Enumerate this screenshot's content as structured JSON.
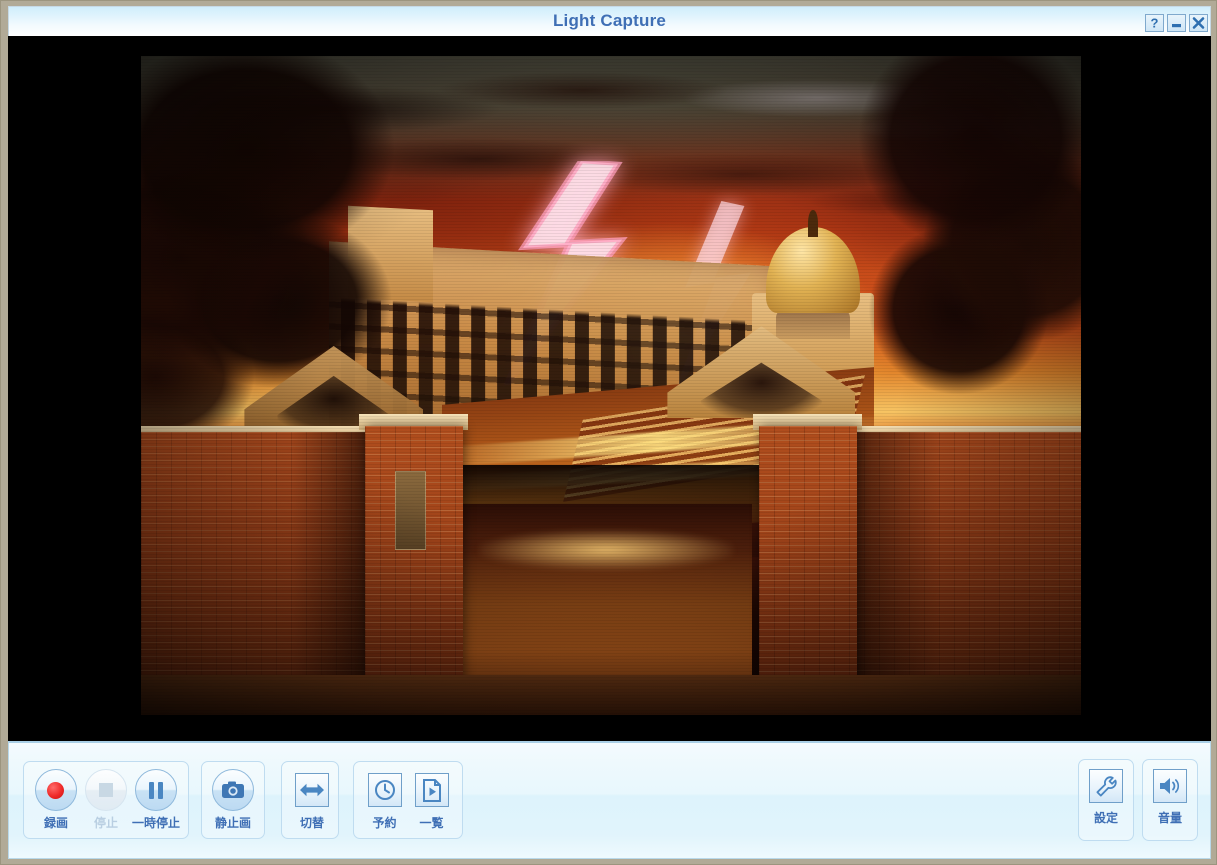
{
  "window": {
    "title": "Light Capture",
    "controls": [
      {
        "name": "help-button",
        "glyph": "?",
        "label": "?"
      },
      {
        "name": "minimize-button",
        "glyph": "_",
        "label": "_"
      },
      {
        "name": "close-button",
        "glyph": "X",
        "label": "X"
      }
    ],
    "frame_color": "#b1aa97",
    "title_color": "#3f6fb5"
  },
  "video": {
    "state": "live-preview",
    "background": "#000000",
    "scene_description": "Night scene with fiery red-orange storm sky, lightning bolt, dark tree silhouettes, a lit school building, a golden-domed hall and a brick gate with stone piers opening to a stepped path"
  },
  "toolbar": {
    "groups": [
      {
        "name": "recording-group",
        "buttons": [
          {
            "name": "record-button",
            "label": "録画",
            "icon": "record-dot-icon",
            "enabled": true,
            "icon_color": "#ef2a2a"
          },
          {
            "name": "stop-button",
            "label": "停止",
            "icon": "stop-square-icon",
            "enabled": false,
            "icon_color": "#c8d8e4"
          },
          {
            "name": "pause-button",
            "label": "一時停止",
            "icon": "pause-bars-icon",
            "enabled": true,
            "icon_color": "#4a86c2"
          }
        ]
      },
      {
        "name": "still-group",
        "buttons": [
          {
            "name": "still-image-button",
            "label": "静止画",
            "icon": "camera-icon",
            "enabled": true,
            "icon_color": "#3f77b5"
          }
        ]
      },
      {
        "name": "switch-group",
        "buttons": [
          {
            "name": "switch-button",
            "label": "切替",
            "icon": "double-arrow-icon",
            "enabled": true,
            "icon_color": "#4a86c2"
          }
        ]
      },
      {
        "name": "schedule-group",
        "buttons": [
          {
            "name": "reserve-button",
            "label": "予約",
            "icon": "clock-icon",
            "enabled": true,
            "icon_color": "#4a86c2"
          },
          {
            "name": "list-button",
            "label": "一覧",
            "icon": "document-play-icon",
            "enabled": true,
            "icon_color": "#4a86c2"
          }
        ]
      }
    ],
    "right_buttons": [
      {
        "name": "settings-button",
        "label": "設定",
        "icon": "wrench-icon",
        "enabled": true
      },
      {
        "name": "volume-button",
        "label": "音量",
        "icon": "speaker-icon",
        "enabled": true
      }
    ],
    "accent_color": "#3f6fb5",
    "disabled_color": "#b9cfe2"
  }
}
